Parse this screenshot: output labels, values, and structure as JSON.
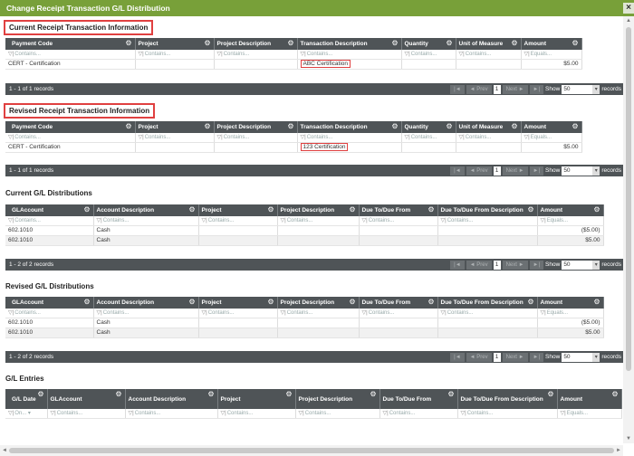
{
  "window": {
    "title": "Change Receipt Transaction G/L Distribution",
    "close": "×"
  },
  "filters": {
    "contains": "Contains...",
    "equals": "Equals...",
    "on": "On..."
  },
  "receipt_columns": [
    "Payment Code",
    "Project",
    "Project Description",
    "Transaction Description",
    "Quantity",
    "Unit of Measure",
    "Amount"
  ],
  "gl_columns": [
    "GLAccount",
    "Account Description",
    "Project",
    "Project Description",
    "Due To/Due From",
    "Due To/Due From Description",
    "Amount"
  ],
  "entries_columns": [
    "G/L Date",
    "GLAccount",
    "Account Description",
    "Project",
    "Project Description",
    "Due To/Due From",
    "Due To/Due From Description",
    "Amount"
  ],
  "current_receipt": {
    "title": "Current Receipt Transaction Information",
    "row": {
      "payment_code": "CERT - Certification",
      "transaction_description": "ABC Certification",
      "amount": "$5.00"
    },
    "pager": "1 - 1 of 1 records"
  },
  "revised_receipt": {
    "title": "Revised Receipt Transaction Information",
    "row": {
      "payment_code": "CERT - Certification",
      "transaction_description": "123 Certification",
      "amount": "$5.00"
    },
    "pager": "1 - 1 of 1 records"
  },
  "current_gl": {
    "title": "Current G/L Distributions",
    "rows": [
      {
        "account": "602.1010",
        "description": "Cash",
        "amount": "($5.00)"
      },
      {
        "account": "602.1010",
        "description": "Cash",
        "amount": "$5.00"
      }
    ],
    "pager": "1 - 2 of 2 records"
  },
  "revised_gl": {
    "title": "Revised G/L Distributions",
    "rows": [
      {
        "account": "602.1010",
        "description": "Cash",
        "amount": "($5.00)"
      },
      {
        "account": "602.1010",
        "description": "Cash",
        "amount": "$5.00"
      }
    ],
    "pager": "1 - 2 of 2 records"
  },
  "gl_entries": {
    "title": "G/L Entries"
  },
  "pager_controls": {
    "prev": "◄ Prev",
    "page": "1",
    "next": "Next ►",
    "show": "Show",
    "page_size": "50",
    "records": "records"
  }
}
